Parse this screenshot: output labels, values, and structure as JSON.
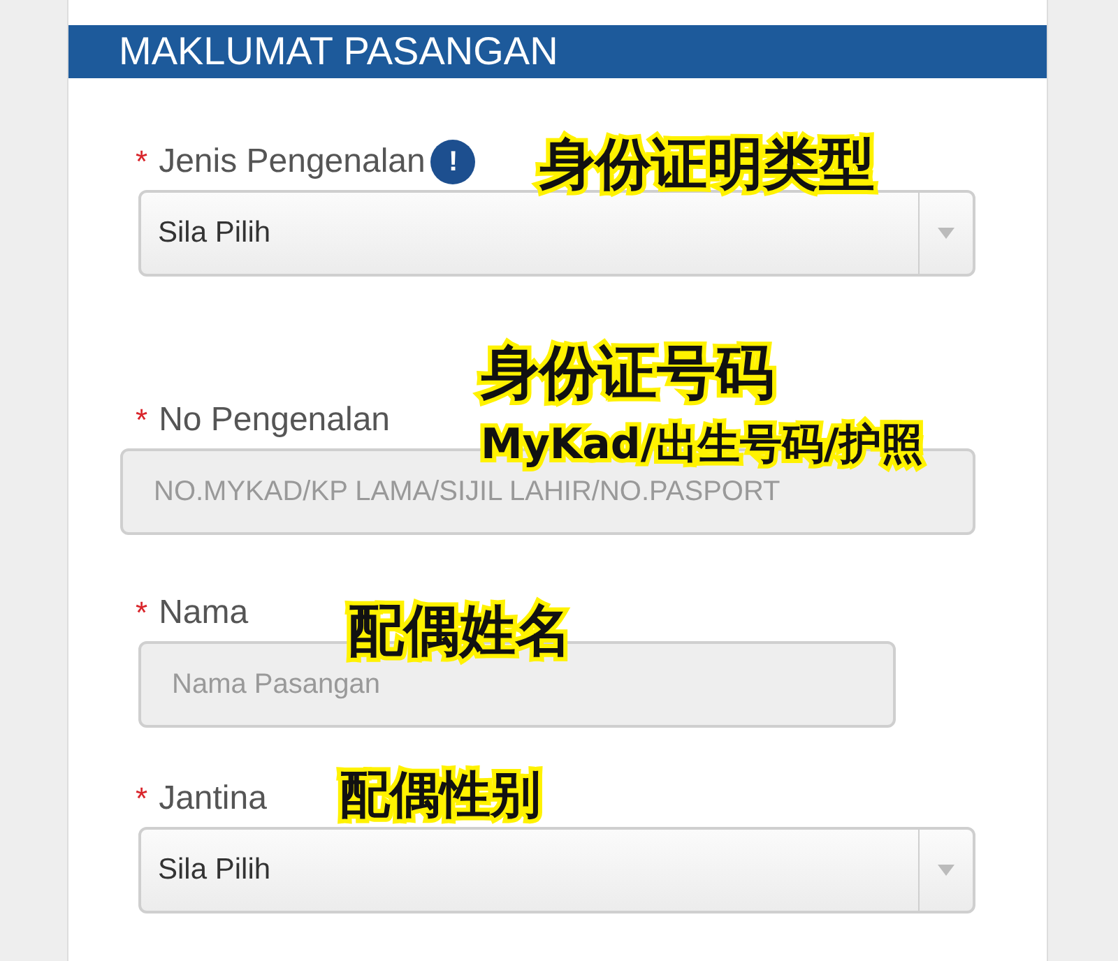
{
  "section": {
    "title": "MAKLUMAT PASANGAN"
  },
  "fields": [
    {
      "kind": "select",
      "marker": "*",
      "label": "Jenis Pengenalan",
      "info": "!",
      "value": "Sila Pilih"
    },
    {
      "kind": "text",
      "marker": "*",
      "label": "No Pengenalan",
      "placeholder": "NO.MYKAD/KP LAMA/SIJIL LAHIR/NO.PASPORT"
    },
    {
      "kind": "text",
      "marker": "*",
      "label": "Nama",
      "placeholder": "Nama Pasangan"
    },
    {
      "kind": "select",
      "marker": "*",
      "label": "Jantina",
      "value": "Sila Pilih"
    }
  ],
  "annotations": [
    {
      "text": "身份证明类型"
    },
    {
      "text": "身份证号码"
    },
    {
      "text": "MyKad/出生号码/护照"
    },
    {
      "text": "配偶姓名"
    },
    {
      "text": "配偶性别"
    }
  ]
}
